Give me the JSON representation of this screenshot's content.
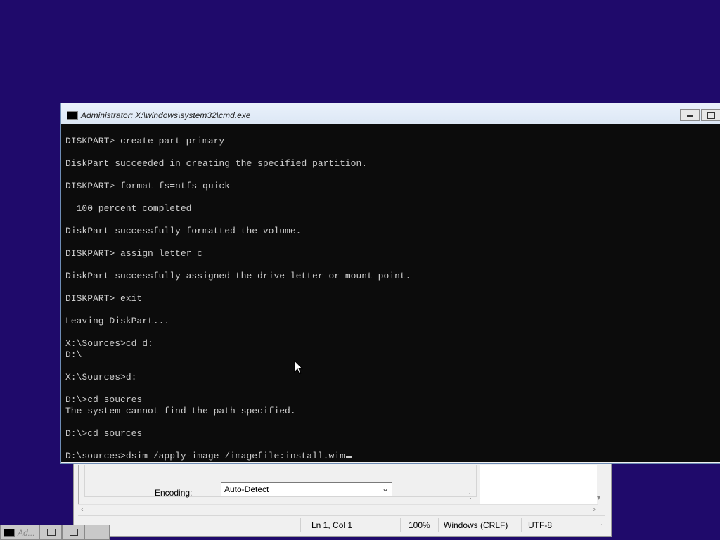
{
  "background_window": {
    "encoding_label": "Encoding:",
    "encoding_value": "Auto-Detect",
    "statusbar": {
      "position": "Ln 1, Col 1",
      "zoom": "100%",
      "line_ending": "Windows (CRLF)",
      "encoding": "UTF-8"
    }
  },
  "taskbar": {
    "main_label": "Ad..."
  },
  "cmd_window": {
    "title": "Administrator: X:\\windows\\system32\\cmd.exe",
    "lines": [
      "DISKPART> create part primary",
      "",
      "DiskPart succeeded in creating the specified partition.",
      "",
      "DISKPART> format fs=ntfs quick",
      "",
      "  100 percent completed",
      "",
      "DiskPart successfully formatted the volume.",
      "",
      "DISKPART> assign letter c",
      "",
      "DiskPart successfully assigned the drive letter or mount point.",
      "",
      "DISKPART> exit",
      "",
      "Leaving DiskPart...",
      "",
      "X:\\Sources>cd d:",
      "D:\\",
      "",
      "X:\\Sources>d:",
      "",
      "D:\\>cd soucres",
      "The system cannot find the path specified.",
      "",
      "D:\\>cd sources",
      "",
      "D:\\sources>dsim /apply-image /imagefile:install.wim"
    ]
  }
}
